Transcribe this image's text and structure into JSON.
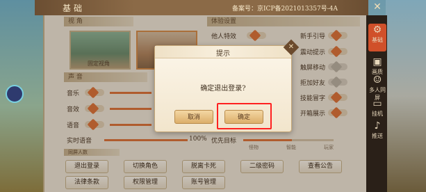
{
  "header": {
    "title": "基础",
    "icp": "备案号：京ICP备2021013357号-4A"
  },
  "sections": {
    "avatar": "视 角",
    "sound": "声 音",
    "experience": "体验设置",
    "friends": "同屏人数"
  },
  "avatar": {
    "tile1_caption": "固定视角"
  },
  "sound": {
    "music": "音乐",
    "effects": "音效",
    "voice": "语音",
    "realtime_voice": "实时语音",
    "realtime_value": "100%"
  },
  "experience": {
    "items_left": [
      "他人特效"
    ],
    "items_right": [
      "新手引导",
      "震动提示",
      "触屏移动",
      "拒加好友",
      "技能冒字",
      "开箱展示"
    ]
  },
  "priority": {
    "label": "优先目标",
    "options": [
      "怪物",
      "智能",
      "玩家"
    ]
  },
  "buttons": [
    "退出登录",
    "切换角色",
    "脱离卡死",
    "二级密码",
    "查看公告",
    "法律条款",
    "权限管理",
    "账号管理"
  ],
  "rail": [
    "基础",
    "画质",
    "多人同屏",
    "挂机",
    "推送"
  ],
  "dialog": {
    "title": "提示",
    "message": "确定退出登录?",
    "cancel": "取消",
    "confirm": "确定"
  },
  "colors": {
    "accent": "#e1743a",
    "highlight": "#ff2020"
  }
}
